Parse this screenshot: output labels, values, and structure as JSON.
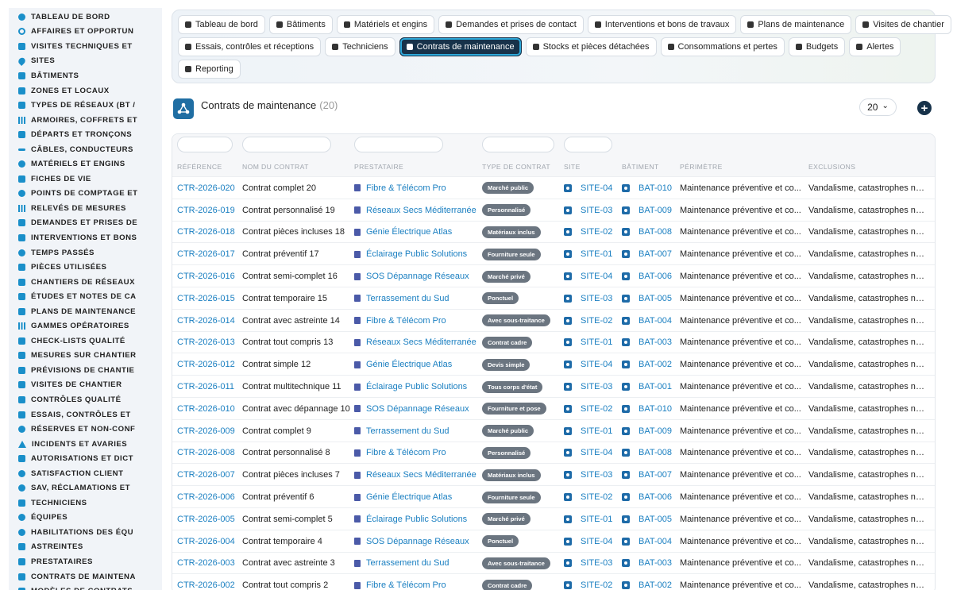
{
  "sidebar": {
    "items": [
      {
        "label": "TABLEAU DE BORD",
        "icon": "dashboard-icon",
        "shape": "round"
      },
      {
        "label": "AFFAIRES ET OPPORTUN",
        "icon": "target-icon",
        "shape": "ring"
      },
      {
        "label": "VISITES TECHNIQUES ET",
        "icon": "clipboard-icon",
        "shape": ""
      },
      {
        "label": "SITES",
        "icon": "pin-icon",
        "shape": "pin"
      },
      {
        "label": "BÂTIMENTS",
        "icon": "building-icon",
        "shape": ""
      },
      {
        "label": "ZONES ET LOCAUX",
        "icon": "door-icon",
        "shape": ""
      },
      {
        "label": "TYPES DE RÉSEAUX (BT /",
        "icon": "network-icon",
        "shape": ""
      },
      {
        "label": "ARMOIRES, COFFRETS ET",
        "icon": "grid-icon",
        "shape": "bars"
      },
      {
        "label": "DÉPARTS ET TRONÇONS",
        "icon": "branch-icon",
        "shape": ""
      },
      {
        "label": "CÂBLES, CONDUCTEURS",
        "icon": "cable-icon",
        "shape": "line"
      },
      {
        "label": "MATÉRIELS ET ENGINS",
        "icon": "cogs-icon",
        "shape": "round"
      },
      {
        "label": "FICHES DE VIE",
        "icon": "file-icon",
        "shape": ""
      },
      {
        "label": "POINTS DE COMPTAGE ET",
        "icon": "gauge-icon",
        "shape": "round"
      },
      {
        "label": "RELEVÉS DE MESURES",
        "icon": "chart-icon",
        "shape": "bars"
      },
      {
        "label": "DEMANDES ET PRISES DE",
        "icon": "inbox-icon",
        "shape": ""
      },
      {
        "label": "INTERVENTIONS ET BONS",
        "icon": "wrench-icon",
        "shape": ""
      },
      {
        "label": "TEMPS PASSÉS",
        "icon": "clock-icon",
        "shape": "round"
      },
      {
        "label": "PIÈCES UTILISÉES",
        "icon": "box-icon",
        "shape": ""
      },
      {
        "label": "CHANTIERS DE RÉSEAUX",
        "icon": "hammer-icon",
        "shape": ""
      },
      {
        "label": "ÉTUDES ET NOTES DE CA",
        "icon": "document-icon",
        "shape": ""
      },
      {
        "label": "PLANS DE MAINTENANCE",
        "icon": "calendar-icon",
        "shape": ""
      },
      {
        "label": "GAMMES OPÉRATOIRES",
        "icon": "list-icon",
        "shape": "bars"
      },
      {
        "label": "CHECK-LISTS QUALITÉ",
        "icon": "checklist-icon",
        "shape": ""
      },
      {
        "label": "MESURES SUR CHANTIER",
        "icon": "ruler-icon",
        "shape": ""
      },
      {
        "label": "PRÉVISIONS DE CHANTIE",
        "icon": "forecast-icon",
        "shape": ""
      },
      {
        "label": "VISITES DE CHANTIER",
        "icon": "walk-icon",
        "shape": ""
      },
      {
        "label": "CONTRÔLES QUALITÉ",
        "icon": "check-icon",
        "shape": ""
      },
      {
        "label": "ESSAIS, CONTRÔLES ET",
        "icon": "flask-icon",
        "shape": ""
      },
      {
        "label": "RÉSERVES ET NON-CONF",
        "icon": "warning-icon",
        "shape": "round"
      },
      {
        "label": "INCIDENTS ET AVARIES",
        "icon": "alert-icon",
        "shape": "tri"
      },
      {
        "label": "AUTORISATIONS ET DICT",
        "icon": "permit-icon",
        "shape": ""
      },
      {
        "label": "SATISFACTION CLIENT",
        "icon": "smile-icon",
        "shape": "round"
      },
      {
        "label": "SAV, RÉCLAMATIONS ET",
        "icon": "chat-icon",
        "shape": "round"
      },
      {
        "label": "TECHNICIENS",
        "icon": "helmet-icon",
        "shape": ""
      },
      {
        "label": "ÉQUIPES",
        "icon": "team-icon",
        "shape": "round"
      },
      {
        "label": "HABILITATIONS DES ÉQU",
        "icon": "badge-icon",
        "shape": "round"
      },
      {
        "label": "ASTREINTES",
        "icon": "phone-icon",
        "shape": ""
      },
      {
        "label": "PRESTATAIRES",
        "icon": "handshake-icon",
        "shape": ""
      },
      {
        "label": "CONTRATS DE MAINTENA",
        "icon": "contract-icon",
        "shape": ""
      },
      {
        "label": "MODÈLES DE CONTRATS",
        "icon": "template-icon",
        "shape": ""
      }
    ]
  },
  "topnav": {
    "rows": [
      [
        {
          "label": "Tableau de bord",
          "icon": "dashboard-icon",
          "active": false
        },
        {
          "label": "Bâtiments",
          "icon": "building-icon",
          "active": false
        },
        {
          "label": "Matériels et engins",
          "icon": "cogs-icon",
          "active": false
        },
        {
          "label": "Demandes et prises de contact",
          "icon": "question-icon",
          "active": false
        },
        {
          "label": "Interventions et bons de travaux",
          "icon": "clipboard-icon",
          "active": false
        },
        {
          "label": "Plans de maintenance",
          "icon": "calendar-icon",
          "active": false
        },
        {
          "label": "Visites de chantier",
          "icon": "walk-icon",
          "active": false
        }
      ],
      [
        {
          "label": "Essais, contrôles et réceptions",
          "icon": "clipboard-check-icon",
          "active": false
        },
        {
          "label": "Techniciens",
          "icon": "helmet-icon",
          "active": false
        },
        {
          "label": "Contrats de maintenance",
          "icon": "file-contract-icon",
          "active": true
        },
        {
          "label": "Stocks et pièces détachées",
          "icon": "boxes-icon",
          "active": false
        },
        {
          "label": "Consommations et pertes",
          "icon": "bolt-icon",
          "active": false
        },
        {
          "label": "Budgets",
          "icon": "money-icon",
          "active": false
        },
        {
          "label": "Alertes",
          "icon": "bell-icon",
          "active": false
        }
      ],
      [
        {
          "label": "Reporting",
          "icon": "chart-pie-icon",
          "active": false
        }
      ]
    ]
  },
  "page": {
    "title": "Contrats de maintenance",
    "count": "(20)",
    "page_size": "20",
    "page_size_caret": "⌄",
    "add_label": "+"
  },
  "table": {
    "columns": [
      "RÉFÉRENCE",
      "NOM DU CONTRAT",
      "PRESTATAIRE",
      "TYPE DE CONTRAT",
      "SITE",
      "BÂTIMENT",
      "PÉRIMÈTRE",
      "EXCLUSIONS"
    ],
    "rows": [
      {
        "ref": "CTR-2026-020",
        "name": "Contrat complet 20",
        "provider": "Fibre & Télécom Pro",
        "type": "Marché public",
        "site": "SITE-04",
        "building": "BAT-010",
        "scope": "Maintenance préventive et co...",
        "exclusions": "Vandalisme, catastrophes nat..."
      },
      {
        "ref": "CTR-2026-019",
        "name": "Contrat personnalisé 19",
        "provider": "Réseaux Secs Méditerranée",
        "type": "Personnalisé",
        "site": "SITE-03",
        "building": "BAT-009",
        "scope": "Maintenance préventive et co...",
        "exclusions": "Vandalisme, catastrophes nat..."
      },
      {
        "ref": "CTR-2026-018",
        "name": "Contrat pièces incluses 18",
        "provider": "Génie Électrique Atlas",
        "type": "Matériaux inclus",
        "site": "SITE-02",
        "building": "BAT-008",
        "scope": "Maintenance préventive et co...",
        "exclusions": "Vandalisme, catastrophes nat..."
      },
      {
        "ref": "CTR-2026-017",
        "name": "Contrat préventif 17",
        "provider": "Éclairage Public Solutions",
        "type": "Fourniture seule",
        "site": "SITE-01",
        "building": "BAT-007",
        "scope": "Maintenance préventive et co...",
        "exclusions": "Vandalisme, catastrophes nat..."
      },
      {
        "ref": "CTR-2026-016",
        "name": "Contrat semi-complet 16",
        "provider": "SOS Dépannage Réseaux",
        "type": "Marché privé",
        "site": "SITE-04",
        "building": "BAT-006",
        "scope": "Maintenance préventive et co...",
        "exclusions": "Vandalisme, catastrophes nat..."
      },
      {
        "ref": "CTR-2026-015",
        "name": "Contrat temporaire 15",
        "provider": "Terrassement du Sud",
        "type": "Ponctuel",
        "site": "SITE-03",
        "building": "BAT-005",
        "scope": "Maintenance préventive et co...",
        "exclusions": "Vandalisme, catastrophes nat..."
      },
      {
        "ref": "CTR-2026-014",
        "name": "Contrat avec astreinte 14",
        "provider": "Fibre & Télécom Pro",
        "type": "Avec sous-traitance",
        "site": "SITE-02",
        "building": "BAT-004",
        "scope": "Maintenance préventive et co...",
        "exclusions": "Vandalisme, catastrophes nat..."
      },
      {
        "ref": "CTR-2026-013",
        "name": "Contrat tout compris 13",
        "provider": "Réseaux Secs Méditerranée",
        "type": "Contrat cadre",
        "site": "SITE-01",
        "building": "BAT-003",
        "scope": "Maintenance préventive et co...",
        "exclusions": "Vandalisme, catastrophes nat..."
      },
      {
        "ref": "CTR-2026-012",
        "name": "Contrat simple 12",
        "provider": "Génie Électrique Atlas",
        "type": "Devis simple",
        "site": "SITE-04",
        "building": "BAT-002",
        "scope": "Maintenance préventive et co...",
        "exclusions": "Vandalisme, catastrophes nat..."
      },
      {
        "ref": "CTR-2026-011",
        "name": "Contrat multitechnique 11",
        "provider": "Éclairage Public Solutions",
        "type": "Tous corps d'état",
        "site": "SITE-03",
        "building": "BAT-001",
        "scope": "Maintenance préventive et co...",
        "exclusions": "Vandalisme, catastrophes nat..."
      },
      {
        "ref": "CTR-2026-010",
        "name": "Contrat avec dépannage 10",
        "provider": "SOS Dépannage Réseaux",
        "type": "Fourniture et pose",
        "site": "SITE-02",
        "building": "BAT-010",
        "scope": "Maintenance préventive et co...",
        "exclusions": "Vandalisme, catastrophes nat..."
      },
      {
        "ref": "CTR-2026-009",
        "name": "Contrat complet 9",
        "provider": "Terrassement du Sud",
        "type": "Marché public",
        "site": "SITE-01",
        "building": "BAT-009",
        "scope": "Maintenance préventive et co...",
        "exclusions": "Vandalisme, catastrophes nat..."
      },
      {
        "ref": "CTR-2026-008",
        "name": "Contrat personnalisé 8",
        "provider": "Fibre & Télécom Pro",
        "type": "Personnalisé",
        "site": "SITE-04",
        "building": "BAT-008",
        "scope": "Maintenance préventive et co...",
        "exclusions": "Vandalisme, catastrophes nat..."
      },
      {
        "ref": "CTR-2026-007",
        "name": "Contrat pièces incluses 7",
        "provider": "Réseaux Secs Méditerranée",
        "type": "Matériaux inclus",
        "site": "SITE-03",
        "building": "BAT-007",
        "scope": "Maintenance préventive et co...",
        "exclusions": "Vandalisme, catastrophes nat..."
      },
      {
        "ref": "CTR-2026-006",
        "name": "Contrat préventif 6",
        "provider": "Génie Électrique Atlas",
        "type": "Fourniture seule",
        "site": "SITE-02",
        "building": "BAT-006",
        "scope": "Maintenance préventive et co...",
        "exclusions": "Vandalisme, catastrophes nat..."
      },
      {
        "ref": "CTR-2026-005",
        "name": "Contrat semi-complet 5",
        "provider": "Éclairage Public Solutions",
        "type": "Marché privé",
        "site": "SITE-01",
        "building": "BAT-005",
        "scope": "Maintenance préventive et co...",
        "exclusions": "Vandalisme, catastrophes nat..."
      },
      {
        "ref": "CTR-2026-004",
        "name": "Contrat temporaire 4",
        "provider": "SOS Dépannage Réseaux",
        "type": "Ponctuel",
        "site": "SITE-04",
        "building": "BAT-004",
        "scope": "Maintenance préventive et co...",
        "exclusions": "Vandalisme, catastrophes nat..."
      },
      {
        "ref": "CTR-2026-003",
        "name": "Contrat avec astreinte 3",
        "provider": "Terrassement du Sud",
        "type": "Avec sous-traitance",
        "site": "SITE-03",
        "building": "BAT-003",
        "scope": "Maintenance préventive et co...",
        "exclusions": "Vandalisme, catastrophes nat..."
      },
      {
        "ref": "CTR-2026-002",
        "name": "Contrat tout compris 2",
        "provider": "Fibre & Télécom Pro",
        "type": "Contrat cadre",
        "site": "SITE-02",
        "building": "BAT-002",
        "scope": "Maintenance préventive et co...",
        "exclusions": "Vandalisme, catastrophes nat..."
      }
    ]
  },
  "colors": {
    "accent": "#1a7fc1",
    "sidebar_icon": "#1a8fc9",
    "active_tab": "#17324a",
    "badge": "#6b7580"
  }
}
